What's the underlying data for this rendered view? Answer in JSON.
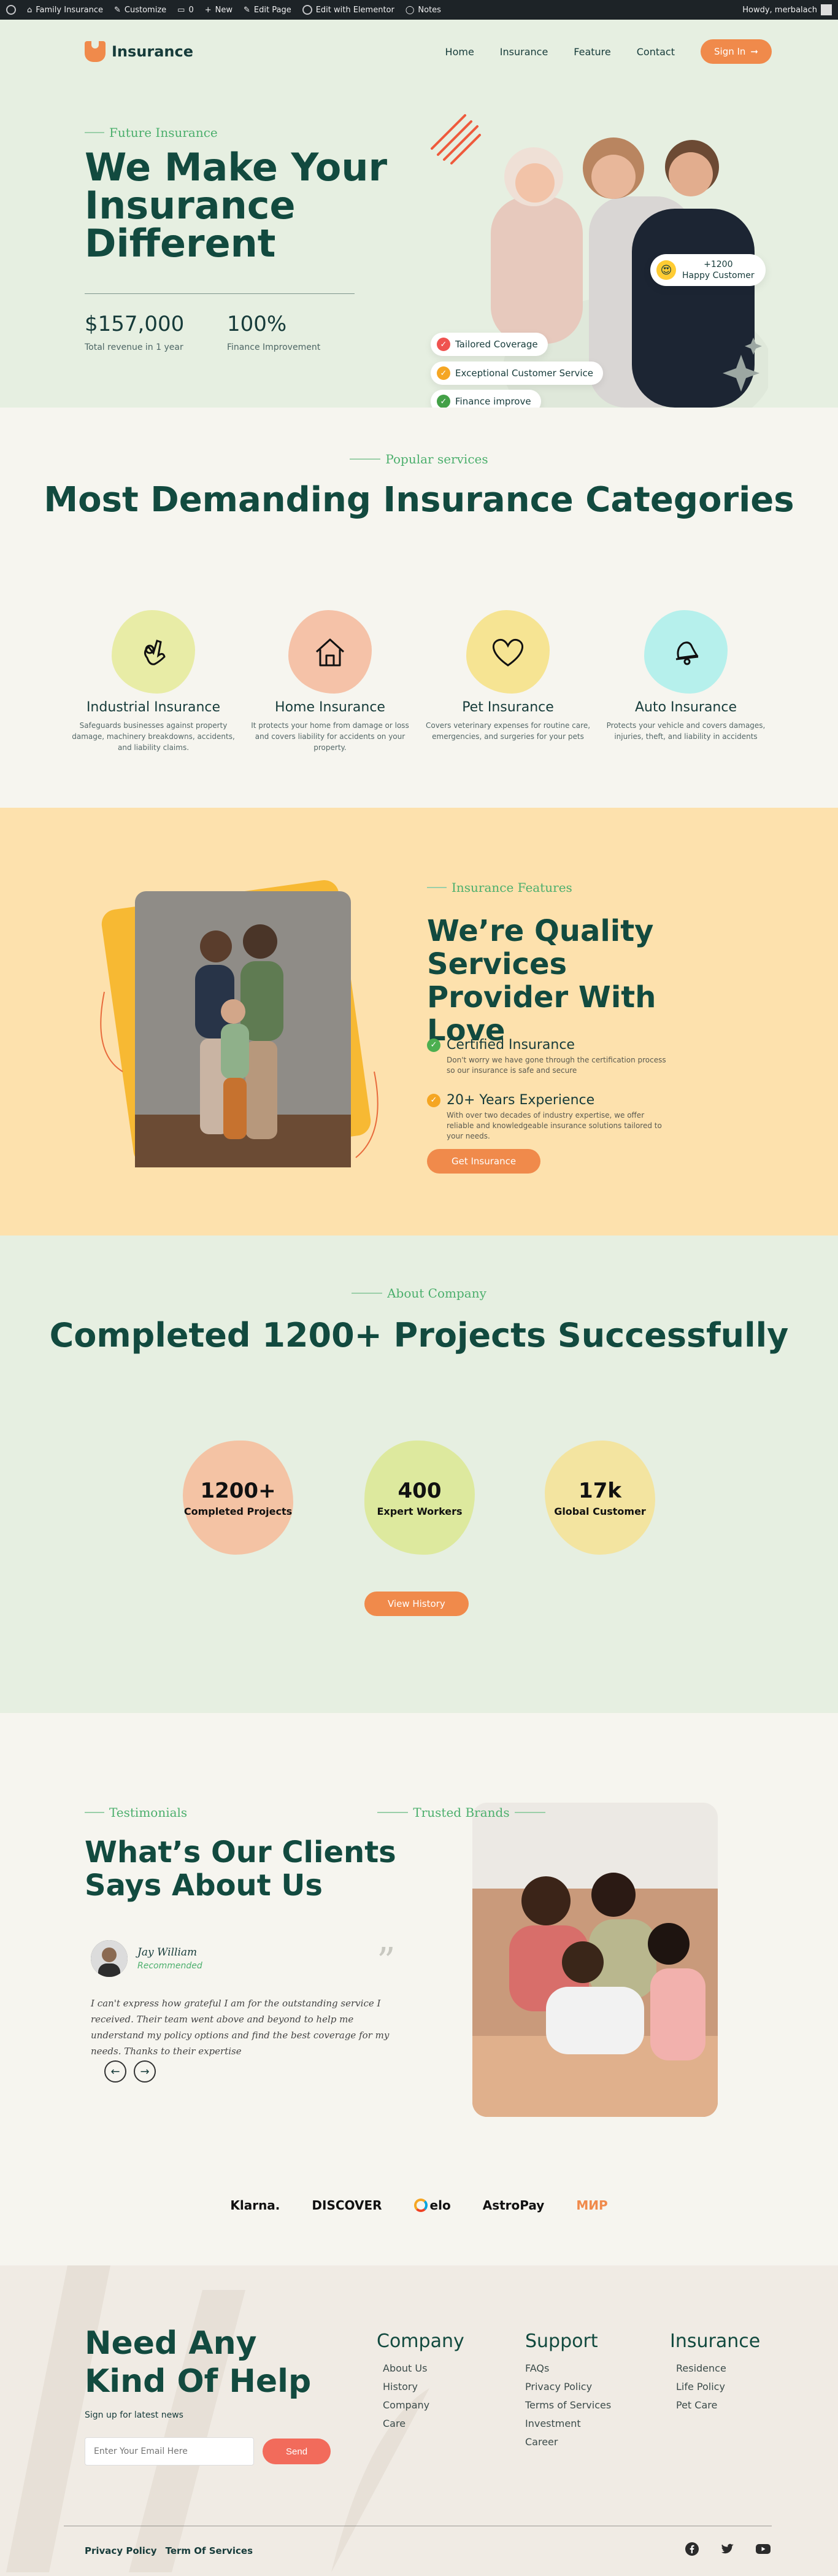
{
  "admin_bar": {
    "site_name": "Family Insurance",
    "customize": "Customize",
    "comments": "0",
    "new": "New",
    "edit_page": "Edit Page",
    "edit_elementor": "Edit with Elementor",
    "notes": "Notes",
    "howdy": "Howdy, merbalach"
  },
  "header": {
    "logo_text": "Insurance",
    "nav": [
      "Home",
      "Insurance",
      "Feature",
      "Contact"
    ],
    "sign_in": "Sign In"
  },
  "hero": {
    "kicker": "Future Insurance",
    "title": "We Make Your Insurance Different",
    "stats": [
      {
        "value": "$157,000",
        "label": "Total revenue in 1 year"
      },
      {
        "value": "100%",
        "label": "Finance Improvement"
      }
    ],
    "badge_count": "+1200",
    "badge_label": "Happy Customer",
    "pills": [
      "Tailored Coverage",
      "Exceptional Customer Service",
      "Finance improve"
    ]
  },
  "services": {
    "kicker": "Popular services",
    "title": "Most Demanding Insurance Categories",
    "items": [
      {
        "title": "Industrial Insurance",
        "desc": "Safeguards businesses against property damage, machinery breakdowns, accidents, and liability claims.",
        "color": "#e8eca6",
        "icon": "ok-hand-icon"
      },
      {
        "title": "Home Insurance",
        "desc": "It protects your home from damage or loss and covers liability for accidents on your property.",
        "color": "#f5c2a8",
        "icon": "house-icon"
      },
      {
        "title": "Pet Insurance",
        "desc": "Covers veterinary expenses for routine care, emergencies, and surgeries for your pets",
        "color": "#f6e493",
        "icon": "heart-icon"
      },
      {
        "title": "Auto Insurance",
        "desc": "Protects your vehicle and covers damages, injuries, theft, and liability in accidents",
        "color": "#b6f0ec",
        "icon": "bell-icon"
      }
    ]
  },
  "features": {
    "kicker": "Insurance Features",
    "title": "We’re Quality Services Provider With Love",
    "items": [
      {
        "title": "Certified Insurance",
        "desc": "Don't worry we have gone through the certification process so our insurance is safe and secure",
        "color": "#4caf50"
      },
      {
        "title": "20+ Years Experience",
        "desc": "With over two decades of industry expertise, we offer reliable and knowledgeable insurance solutions tailored to your needs.",
        "color": "#f5a623"
      }
    ],
    "cta": "Get Insurance"
  },
  "about": {
    "kicker": "About Company",
    "title": "Completed 1200+ Projects Successfully",
    "stats": [
      {
        "num": "1200+",
        "caption": "Completed Projects",
        "color": "#f4c3a4"
      },
      {
        "num": "400",
        "caption": "Expert Workers",
        "color": "#dde99e"
      },
      {
        "num": "17k",
        "caption": "Global Customer",
        "color": "#f3e4a0"
      }
    ],
    "cta": "View History"
  },
  "testimonials": {
    "kicker": "Testimonials",
    "title": "What’s Our Clients Says About Us",
    "name": "Jay William",
    "role": "Recommended",
    "quote": "I can't express how grateful I am for the outstanding service I received. Their team went above and beyond to help me understand my policy options and find the best coverage for my needs. Thanks to their expertise",
    "brands_kicker": "Trusted Brands",
    "brands": [
      "Klarna.",
      "DISCOVER",
      "elo",
      "AstroPay",
      "МИР"
    ]
  },
  "footer": {
    "headline": "Need Any Kind Of Help",
    "signup": "Sign up for latest news",
    "email_placeholder": "Enter Your Email Here",
    "send": "Send",
    "columns": [
      {
        "title": "Company",
        "links": [
          "About Us",
          "History",
          "Company",
          "Care"
        ]
      },
      {
        "title": "Support",
        "links": [
          "FAQs",
          "Privacy Policy",
          "Terms of Services",
          "Investment",
          "Career"
        ]
      },
      {
        "title": "Insurance",
        "links": [
          "Residence",
          "Life Policy",
          "Pet Care"
        ]
      }
    ],
    "legal": [
      "Privacy Policy",
      "Term Of Services"
    ]
  },
  "colors": {
    "accent": "#f08a4b",
    "heading": "#124a3f",
    "hero_bg": "#e6efe1",
    "features_bg": "#fde1ad",
    "send": "#f26b5b"
  }
}
